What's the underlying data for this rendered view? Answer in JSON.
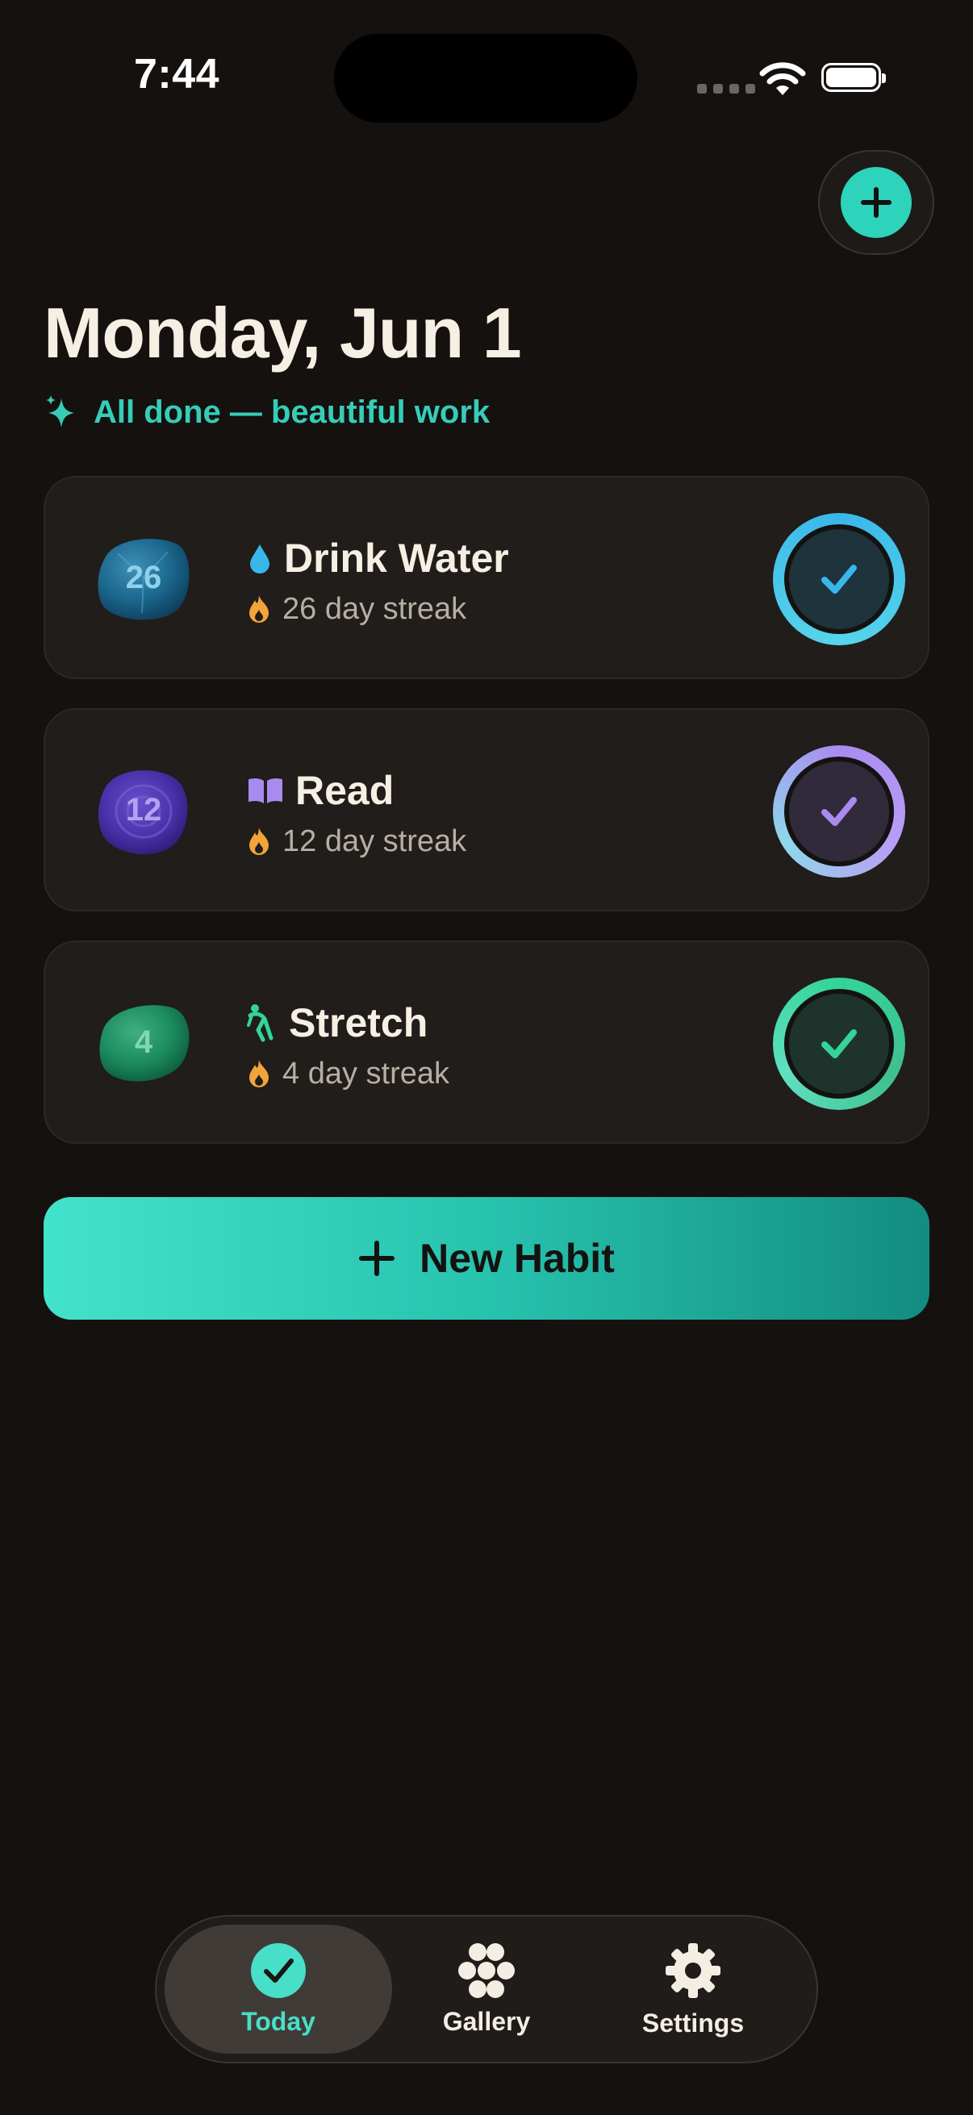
{
  "status_bar": {
    "time": "7:44"
  },
  "header": {
    "title": "Monday, Jun 1",
    "subtitle": "All done — beautiful work"
  },
  "habits": [
    {
      "name": "Drink Water",
      "streak_label": "26 day streak",
      "stone_number": "26",
      "icon": "water-drop-icon",
      "color": "#3ab7ea",
      "completed": true
    },
    {
      "name": "Read",
      "streak_label": "12 day streak",
      "stone_number": "12",
      "icon": "open-book-icon",
      "color": "#a98bf0",
      "completed": true
    },
    {
      "name": "Stretch",
      "streak_label": "4 day streak",
      "stone_number": "4",
      "icon": "stretching-figure-icon",
      "color": "#34d39a",
      "completed": true
    }
  ],
  "actions": {
    "new_habit_label": "New Habit"
  },
  "tabbar": {
    "items": [
      {
        "label": "Today",
        "icon": "check-circle-icon",
        "active": true
      },
      {
        "label": "Gallery",
        "icon": "flower-dots-icon",
        "active": false
      },
      {
        "label": "Settings",
        "icon": "gear-icon",
        "active": false
      }
    ]
  },
  "colors": {
    "background": "#14110f",
    "accent": "#2ed3bb",
    "card": "#201d1a",
    "flame": "#f2a33a"
  }
}
